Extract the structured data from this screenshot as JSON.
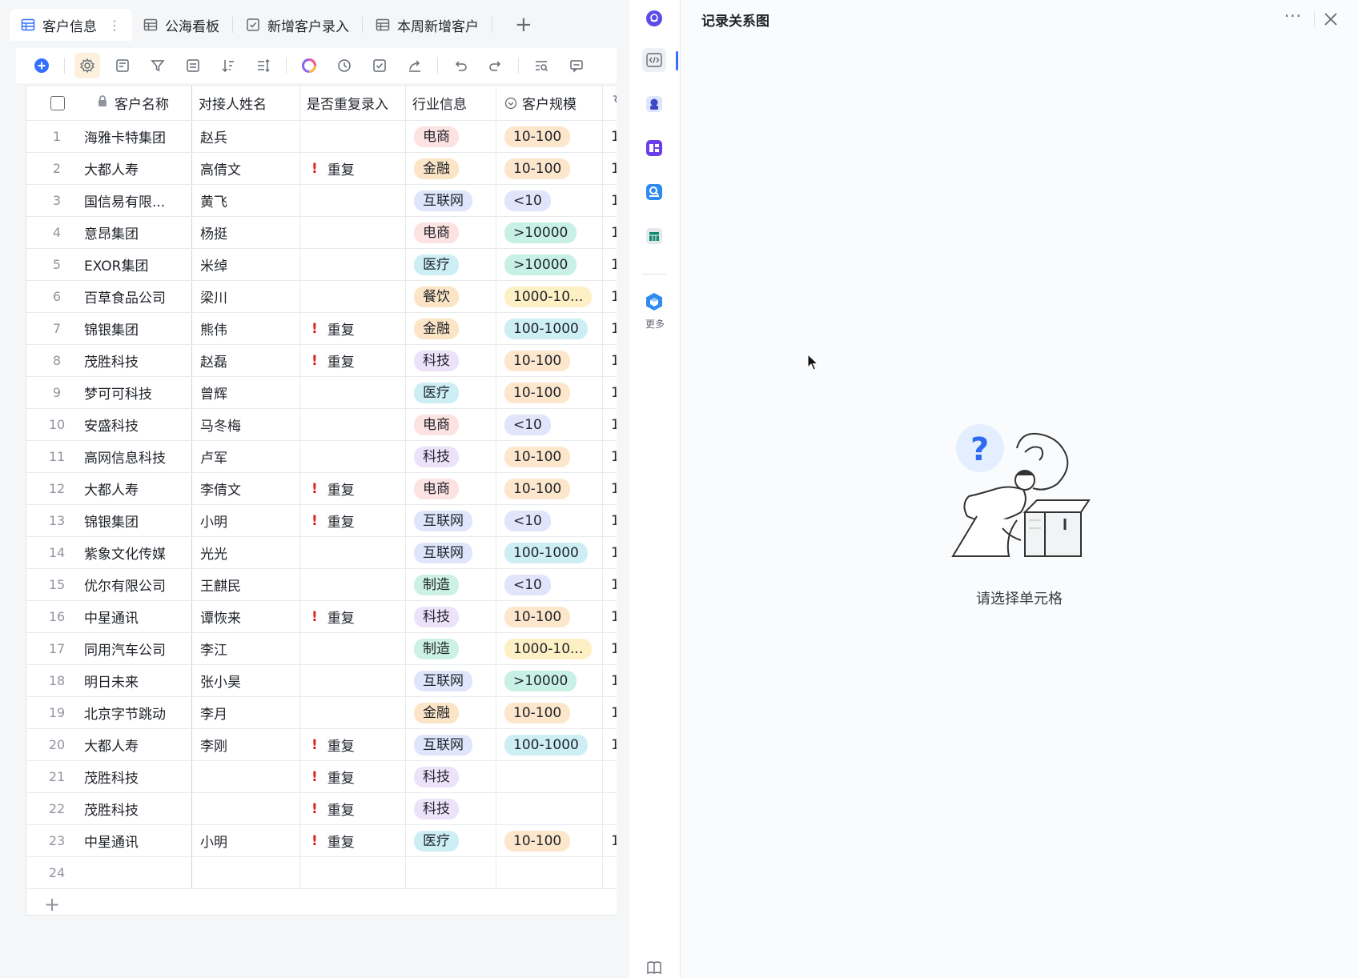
{
  "tabs": [
    {
      "label": "客户信息",
      "icon": "grid-table-icon",
      "active": true
    },
    {
      "label": "公海看板",
      "icon": "grid-table-icon",
      "active": false
    },
    {
      "label": "新增客户录入",
      "icon": "form-check-icon",
      "active": false
    },
    {
      "label": "本周新增客户",
      "icon": "grid-table-icon",
      "active": false
    }
  ],
  "toolbar": {
    "icons": [
      "add-record-icon",
      "settings-icon",
      "field-icon",
      "filter-icon",
      "group-icon",
      "sort-icon",
      "row-height-icon",
      "color-icon",
      "history-icon",
      "checklist-icon",
      "share-icon",
      "undo-icon",
      "redo-icon",
      "search-icon",
      "comment-icon"
    ]
  },
  "columns": {
    "name": "客户名称",
    "contact": "对接人姓名",
    "duplicate": "是否重复录入",
    "industry": "行业信息",
    "scale": "客户规模"
  },
  "rows": [
    {
      "num": "1",
      "name": "海雅卡特集团",
      "contact": "赵兵",
      "dup": "",
      "industry": "电商",
      "scale": "10-100",
      "extra": "1"
    },
    {
      "num": "2",
      "name": "大都人寿",
      "contact": "高倩文",
      "dup": "重复",
      "industry": "金融",
      "scale": "10-100",
      "extra": "1"
    },
    {
      "num": "3",
      "name": "国信易有限...",
      "contact": "黄飞",
      "dup": "",
      "industry": "互联网",
      "scale": "<10",
      "extra": "1"
    },
    {
      "num": "4",
      "name": "意昂集团",
      "contact": "杨挺",
      "dup": "",
      "industry": "电商",
      "scale": ">10000",
      "extra": "1"
    },
    {
      "num": "5",
      "name": "EXOR集团",
      "contact": "米绰",
      "dup": "",
      "industry": "医疗",
      "scale": ">10000",
      "extra": "1"
    },
    {
      "num": "6",
      "name": "百草食品公司",
      "contact": "梁川",
      "dup": "",
      "industry": "餐饮",
      "scale": "1000-10...",
      "extra": "1"
    },
    {
      "num": "7",
      "name": "锦银集团",
      "contact": "熊伟",
      "dup": "重复",
      "industry": "金融",
      "scale": "100-1000",
      "extra": "1"
    },
    {
      "num": "8",
      "name": "茂胜科技",
      "contact": "赵磊",
      "dup": "重复",
      "industry": "科技",
      "scale": "10-100",
      "extra": "1"
    },
    {
      "num": "9",
      "name": "梦可可科技",
      "contact": "曾辉",
      "dup": "",
      "industry": "医疗",
      "scale": "10-100",
      "extra": "1"
    },
    {
      "num": "10",
      "name": "安盛科技",
      "contact": "马冬梅",
      "dup": "",
      "industry": "电商",
      "scale": "<10",
      "extra": "1"
    },
    {
      "num": "11",
      "name": "高网信息科技",
      "contact": "卢军",
      "dup": "",
      "industry": "科技",
      "scale": "10-100",
      "extra": "1"
    },
    {
      "num": "12",
      "name": "大都人寿",
      "contact": "李倩文",
      "dup": "重复",
      "industry": "电商",
      "scale": "10-100",
      "extra": "1"
    },
    {
      "num": "13",
      "name": "锦银集团",
      "contact": "小明",
      "dup": "重复",
      "industry": "互联网",
      "scale": "<10",
      "extra": "1"
    },
    {
      "num": "14",
      "name": "紫象文化传媒",
      "contact": "光光",
      "dup": "",
      "industry": "互联网",
      "scale": "100-1000",
      "extra": "1"
    },
    {
      "num": "15",
      "name": "优尔有限公司",
      "contact": "王麒民",
      "dup": "",
      "industry": "制造",
      "scale": "<10",
      "extra": "1"
    },
    {
      "num": "16",
      "name": "中星通讯",
      "contact": "谭恢来",
      "dup": "重复",
      "industry": "科技",
      "scale": "10-100",
      "extra": "1"
    },
    {
      "num": "17",
      "name": "同用汽车公司",
      "contact": "李江",
      "dup": "",
      "industry": "制造",
      "scale": "1000-10...",
      "extra": "1"
    },
    {
      "num": "18",
      "name": "明日未来",
      "contact": "张小昊",
      "dup": "",
      "industry": "互联网",
      "scale": ">10000",
      "extra": "1"
    },
    {
      "num": "19",
      "name": "北京字节跳动",
      "contact": "李月",
      "dup": "",
      "industry": "金融",
      "scale": "10-100",
      "extra": "1"
    },
    {
      "num": "20",
      "name": "大都人寿",
      "contact": "李刚",
      "dup": "重复",
      "industry": "互联网",
      "scale": "100-1000",
      "extra": "1"
    },
    {
      "num": "21",
      "name": "茂胜科技",
      "contact": "",
      "dup": "重复",
      "industry": "科技",
      "scale": "",
      "extra": ""
    },
    {
      "num": "22",
      "name": "茂胜科技",
      "contact": "",
      "dup": "重复",
      "industry": "科技",
      "scale": "",
      "extra": ""
    },
    {
      "num": "23",
      "name": "中星通讯",
      "contact": "小明",
      "dup": "重复",
      "industry": "医疗",
      "scale": "10-100",
      "extra": "1"
    },
    {
      "num": "24",
      "name": "",
      "contact": "",
      "dup": "",
      "industry": "",
      "scale": "",
      "extra": ""
    }
  ],
  "industry_colors": {
    "电商": "#fde2e2",
    "金融": "#fbe5c6",
    "互联网": "#dfe6fb",
    "医疗": "#cdeef5",
    "餐饮": "#fbe5c6",
    "科技": "#ece3fb",
    "制造": "#cdf1e3"
  },
  "scale_colors": {
    "10-100": "#fde6cc",
    "<10": "#e0e5fb",
    ">10000": "#c9f0e4",
    "1000-10...": "#fdf0c4",
    "100-1000": "#cdeef5"
  },
  "strip": {
    "icons": [
      "chat-icon",
      "code-icon",
      "robot-icon",
      "dashboard-icon",
      "search-doc-icon",
      "table-app-icon",
      "cube-icon",
      "book-icon"
    ],
    "more_label": "更多"
  },
  "panel": {
    "title": "记录关系图",
    "more": "···",
    "empty_text": "请选择单元格"
  }
}
